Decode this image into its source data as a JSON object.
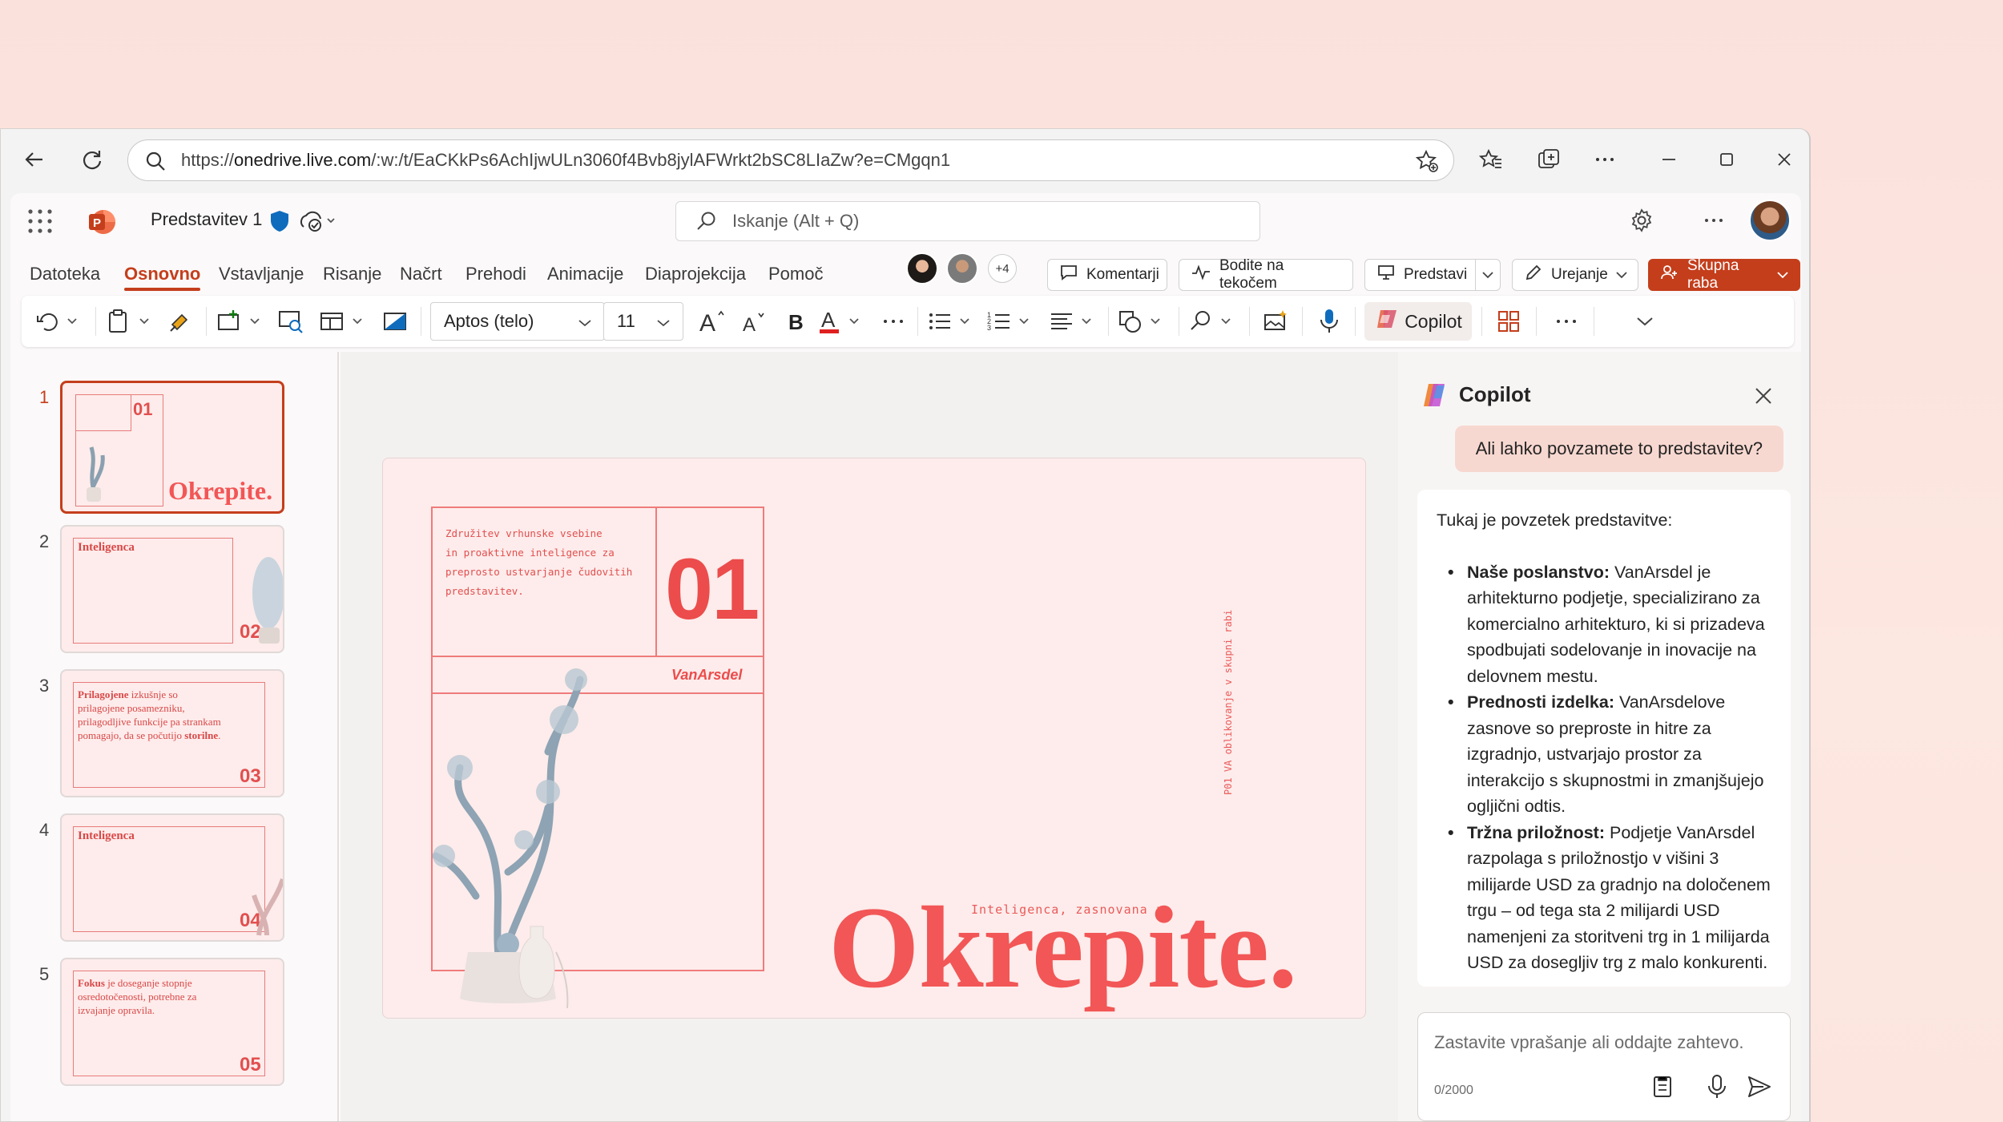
{
  "browser": {
    "url_prefix": "https://",
    "url_host": "onedrive.live.com",
    "url_rest": "/:w:/t/EaCKkPs6AchIjwULn3060f4Bvb8jylAFWrkt2bSC8LIaZw?e=CMgqn1"
  },
  "app": {
    "doc_title": "Predstavitev 1",
    "search_placeholder": "Iskanje (Alt + Q)",
    "presence_extra": "+4"
  },
  "ribbon": {
    "tabs": [
      "Datoteka",
      "Osnovno",
      "Vstavljanje",
      "Risanje",
      "Načrt",
      "Prehodi",
      "Animacije",
      "Diaprojekcija",
      "Pomoč"
    ],
    "comments_label": "Komentarji",
    "catchup_label": "Bodite na tekočem",
    "present_label": "Predstavi",
    "editing_label": "Urejanje",
    "share_label": "Skupna raba"
  },
  "toolbar": {
    "font_name": "Aptos (telo)",
    "font_size": "11",
    "copilot_label": "Copilot",
    "font_color": "#e02020"
  },
  "thumbnails": [
    {
      "num": "1",
      "title": "Okrepite.",
      "badge": "01"
    },
    {
      "num": "2",
      "title": "Inteligenca",
      "badge": "02"
    },
    {
      "num": "3",
      "title": "",
      "badge": "03",
      "body_strong": "Prilagojene",
      "body": " izkušnje so prilagojene posamezniku, prilagodljive funkcije pa strankam pomagajo, da se počutijo ",
      "body_end": "storilne",
      "body_dot": "."
    },
    {
      "num": "4",
      "title": "Inteligenca",
      "badge": "04"
    },
    {
      "num": "5",
      "title": "",
      "badge": "05",
      "body_strong": "Fokus",
      "body": " je doseganje stopnje osredotočenosti, potrebne za izvajanje opravila."
    }
  ],
  "slide": {
    "intro_lines": [
      "Združitev vrhunske vsebine",
      "in proaktivne inteligence za",
      "preprosto ustvarjanje čudovitih",
      "predstavitev."
    ],
    "number": "01",
    "brand": "VanArsdel",
    "vertical_text": "P01 VA oblikovanje v skupni rabi",
    "subtitle": "Inteligenca, zasnovana za",
    "title": "Okrepite."
  },
  "copilot": {
    "title": "Copilot",
    "user_message": "Ali lahko povzamete to predstavitev?",
    "answer_intro": "Tukaj je povzetek predstavitve:",
    "bullets": [
      {
        "head": "Naše poslanstvo:",
        "text": " VanArsdel je arhitekturno podjetje, specializirano za komercialno arhitekturo, ki si prizadeva spodbujati sodelovanje in inovacije na delovnem mestu."
      },
      {
        "head": "Prednosti izdelka:",
        "text": " VanArsdelove zasnove so preproste in hitre za izgradnjo, ustvarjajo prostor za interakcijo s skupnostmi in zmanjšujejo ogljični odtis."
      },
      {
        "head": "Tržna priložnost:",
        "text": " Podjetje VanArsdel razpolaga s priložnostjo v višini 3 milijarde USD za gradnjo na določenem trgu – od tega sta 2 milijardi USD namenjeni za storitveni trg in 1 milijarda USD za dosegljiv trg z malo konkurenti."
      }
    ],
    "input_placeholder": "Zastavite vprašanje ali oddajte zahtevo.",
    "char_count": "0/2000"
  },
  "colors": {
    "accent": "#c43e1c",
    "slide_red": "#ec4c4c",
    "slide_bg": "#fdeceb"
  }
}
